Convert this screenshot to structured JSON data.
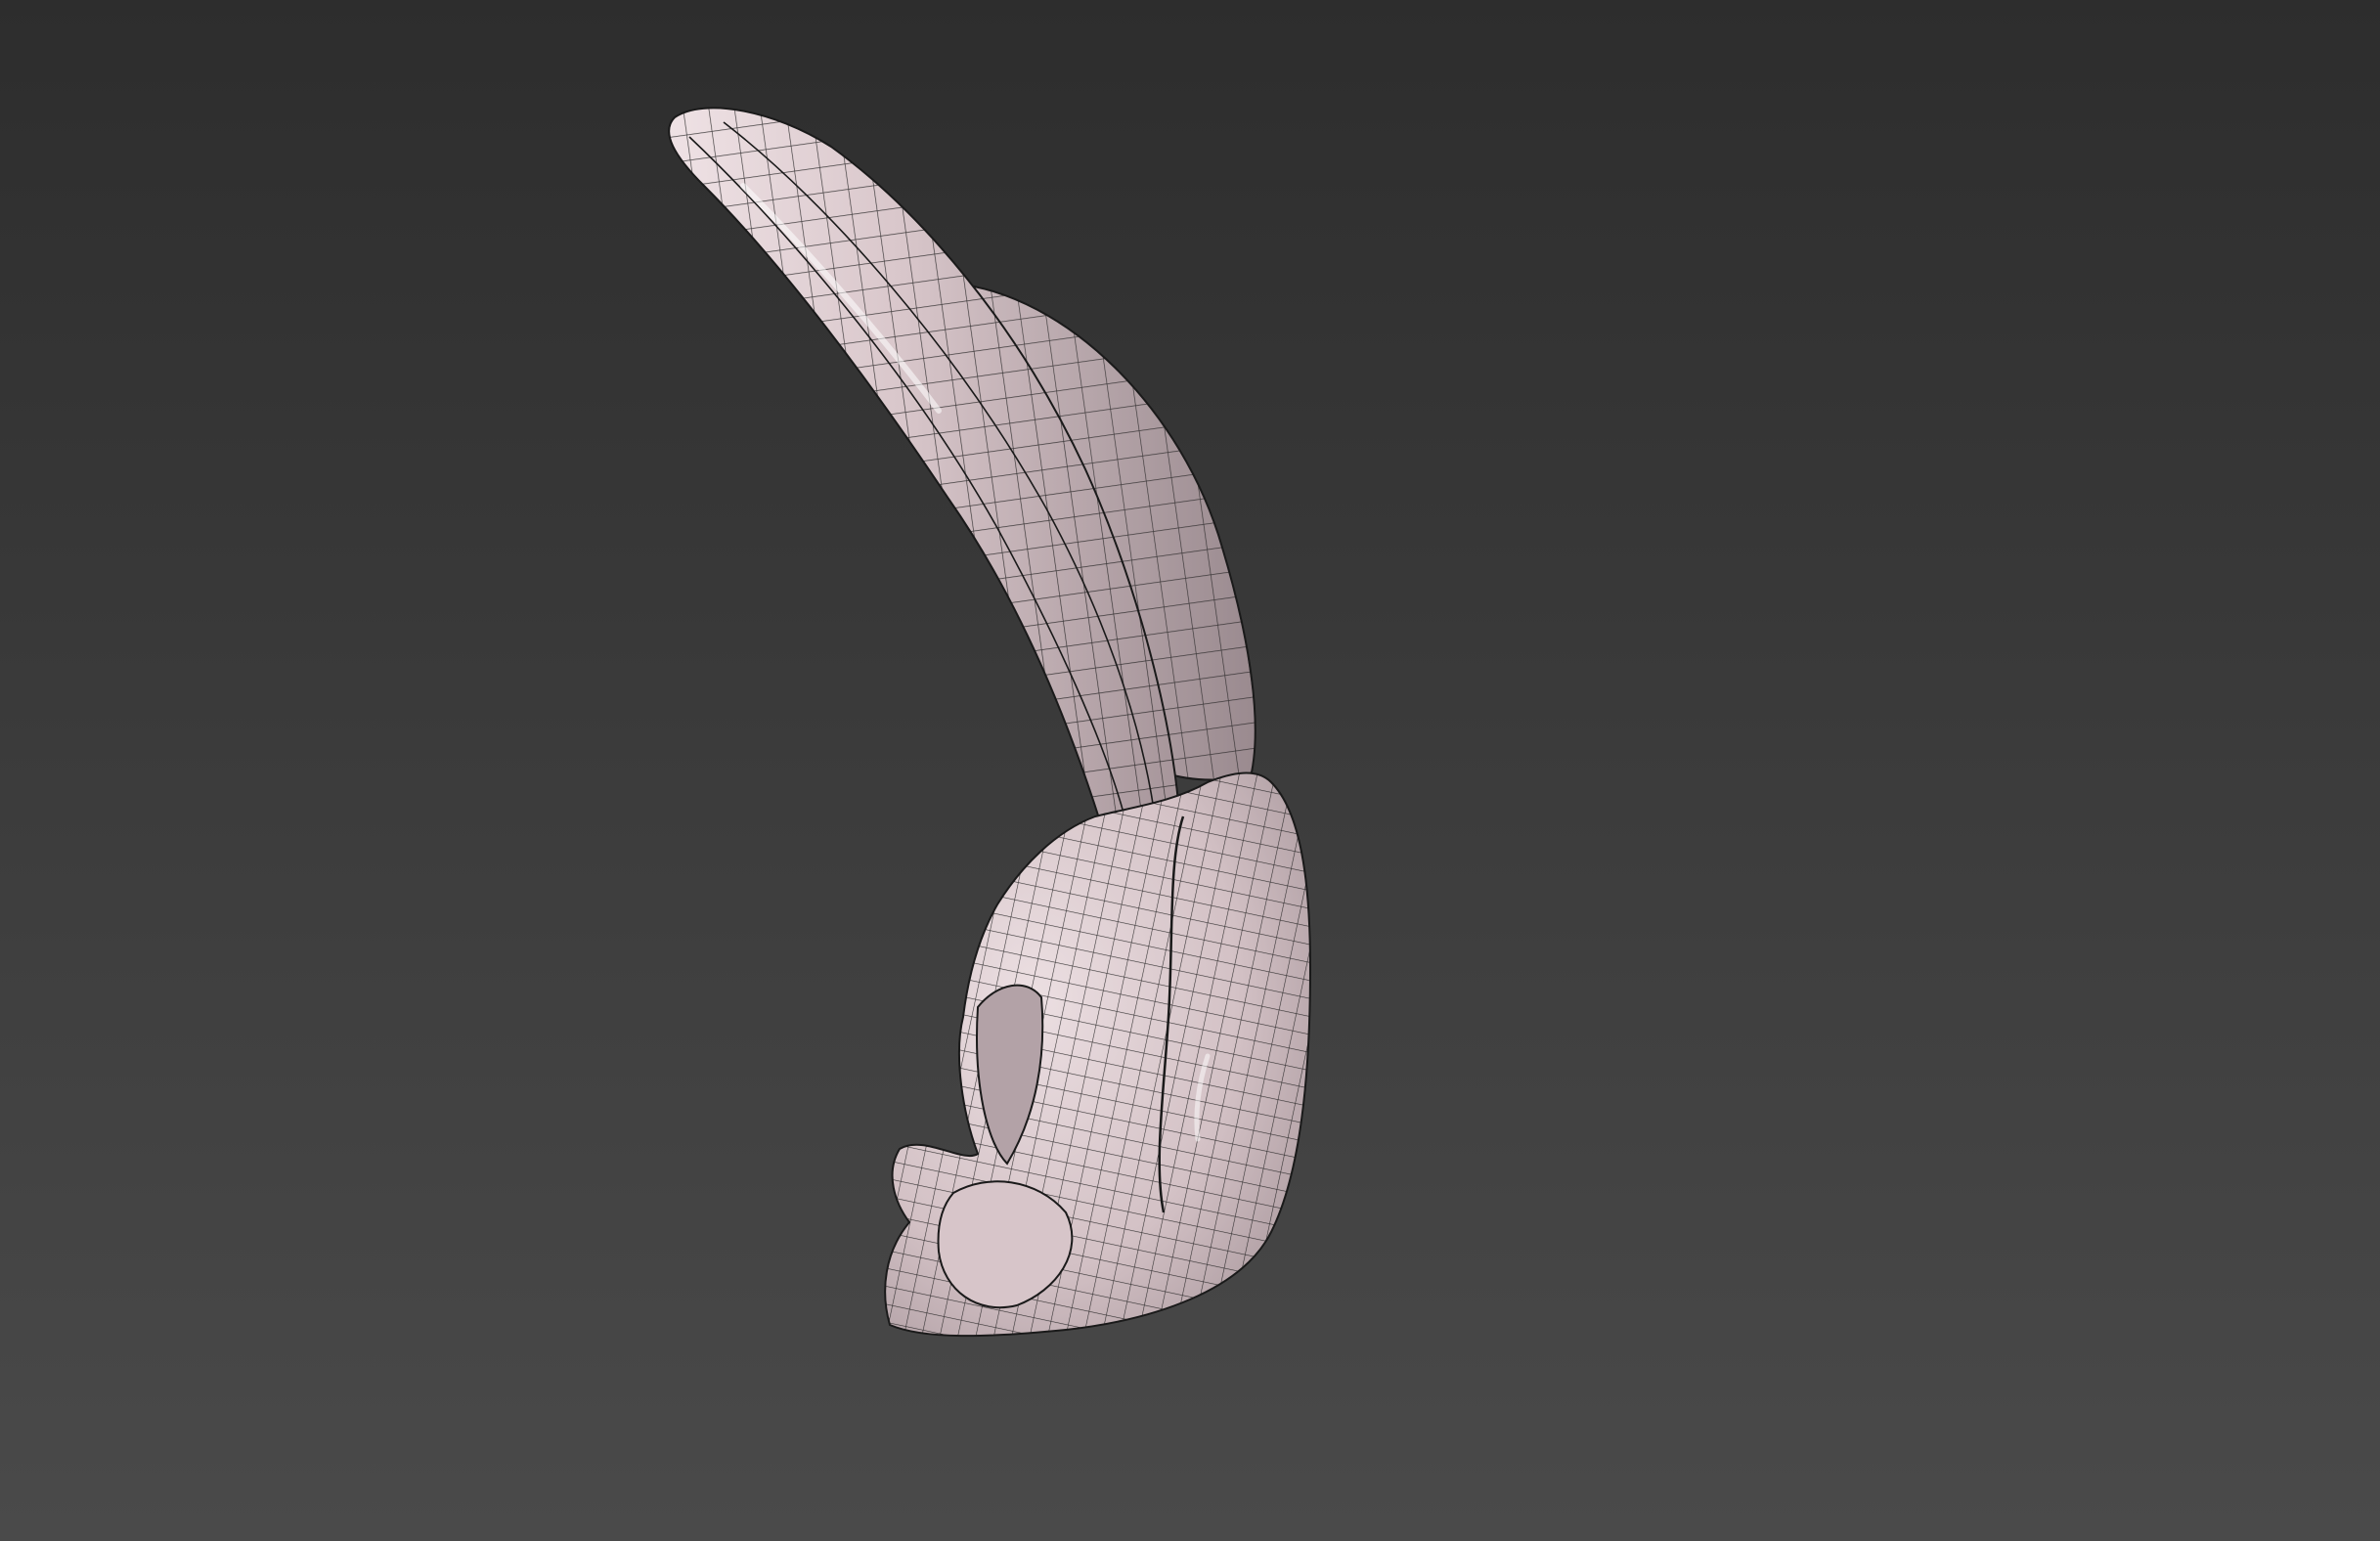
{
  "viewport": {
    "background_top": "#2d2d2d",
    "background_bottom": "#4a4a4a",
    "model": {
      "description_icon": "mesh-model",
      "surface_color": "#d7c5c9",
      "shadow_color": "#8a7b80",
      "wire_color": "#1a1a1a"
    }
  }
}
